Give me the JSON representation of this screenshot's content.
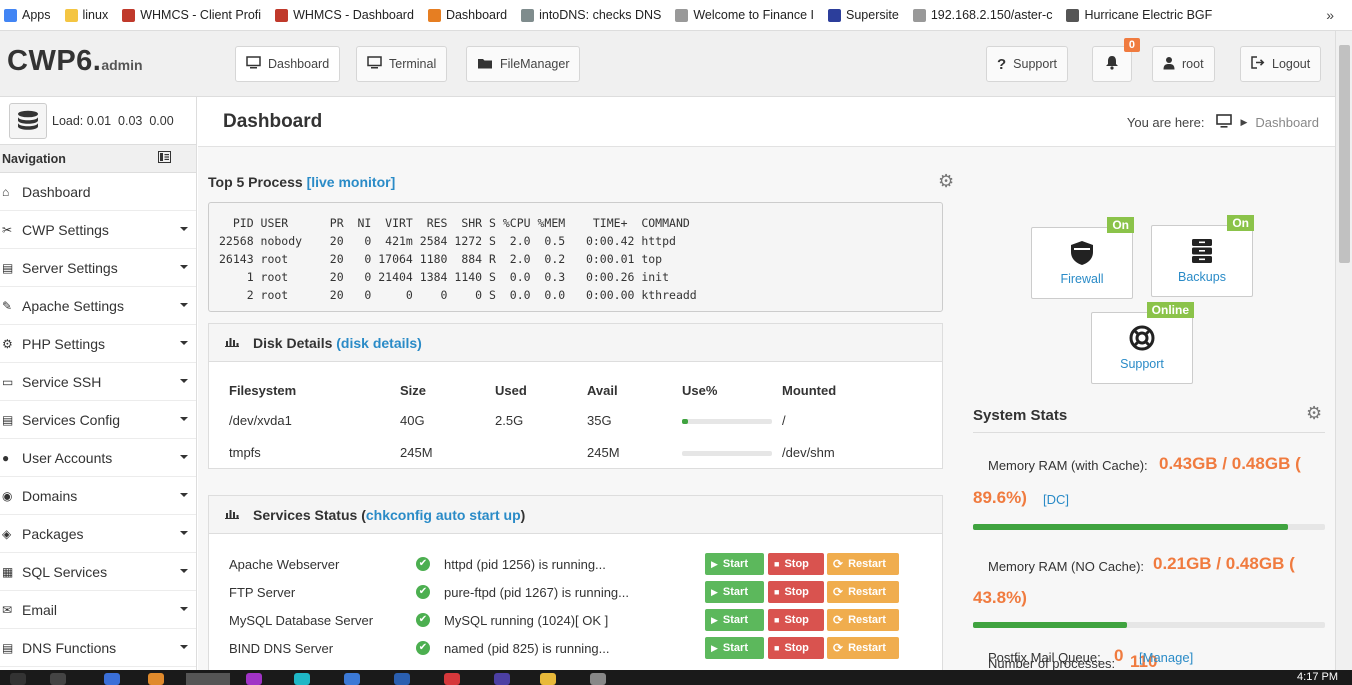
{
  "bookmarks": [
    {
      "label": "Apps",
      "color": "#4285f4"
    },
    {
      "label": "linux",
      "color": "#f4c542"
    },
    {
      "label": "WHMCS - Client Profi",
      "color": "#c0392b"
    },
    {
      "label": "WHMCS - Dashboard",
      "color": "#c0392b"
    },
    {
      "label": "Dashboard",
      "color": "#e67e22"
    },
    {
      "label": "intoDNS: checks DNS",
      "color": "#7f8c8d"
    },
    {
      "label": "Welcome to Finance I",
      "color": "#999999"
    },
    {
      "label": "Supersite",
      "color": "#2c3e9b"
    },
    {
      "label": "192.168.2.150/aster-c",
      "color": "#999999"
    },
    {
      "label": "Hurricane Electric BGF",
      "color": "#555555"
    }
  ],
  "bookmarks_more": "»",
  "brand": {
    "name": "CWP6.",
    "suffix": "admin"
  },
  "topnav": {
    "dashboard": "Dashboard",
    "terminal": "Terminal",
    "filemanager": "FileManager",
    "support": "Support",
    "notifications_count": "0",
    "user": "root",
    "logout": "Logout"
  },
  "sidebar": {
    "load_label": "Load:",
    "load_values": "0.01  0.03  0.00",
    "nav_title": "Navigation",
    "items": [
      {
        "label": "Dashboard",
        "has_caret": false
      },
      {
        "label": "CWP Settings",
        "has_caret": true
      },
      {
        "label": "Server Settings",
        "has_caret": true
      },
      {
        "label": "Apache Settings",
        "has_caret": true
      },
      {
        "label": "PHP Settings",
        "has_caret": true
      },
      {
        "label": "Service SSH",
        "has_caret": true
      },
      {
        "label": "Services Config",
        "has_caret": true
      },
      {
        "label": "User Accounts",
        "has_caret": true
      },
      {
        "label": "Domains",
        "has_caret": true
      },
      {
        "label": "Packages",
        "has_caret": true
      },
      {
        "label": "SQL Services",
        "has_caret": true
      },
      {
        "label": "Email",
        "has_caret": true
      },
      {
        "label": "DNS Functions",
        "has_caret": true
      }
    ]
  },
  "page": {
    "title": "Dashboard",
    "breadcrumb_prefix": "You are here:",
    "breadcrumb_current": "Dashboard"
  },
  "top_process": {
    "title": "Top 5 Process",
    "link": "[live monitor]",
    "output": "  PID USER      PR  NI  VIRT  RES  SHR S %CPU %MEM    TIME+  COMMAND\n22568 nobody    20   0  421m 2584 1272 S  2.0  0.5   0:00.42 httpd\n26143 root      20   0 17064 1180  884 R  2.0  0.2   0:00.01 top\n    1 root      20   0 21404 1384 1140 S  0.0  0.3   0:00.26 init\n    2 root      20   0     0    0    0 S  0.0  0.0   0:00.00 kthreadd"
  },
  "disk": {
    "title": "Disk Details",
    "link": "(disk details)",
    "headers": [
      "Filesystem",
      "Size",
      "Used",
      "Avail",
      "Use%",
      "Mounted"
    ],
    "rows": [
      {
        "fs": "/dev/xvda1",
        "size": "40G",
        "used": "2.5G",
        "avail": "35G",
        "use_pct": 7,
        "mounted": "/"
      },
      {
        "fs": "tmpfs",
        "size": "245M",
        "used": "",
        "avail": "245M",
        "use_pct": 0,
        "mounted": "/dev/shm"
      }
    ]
  },
  "services": {
    "title": "Services Status",
    "link": "chkconfig auto start up",
    "open_paren": "(",
    "close_paren": ")",
    "start_label": "Start",
    "stop_label": "Stop",
    "restart_label": "Restart",
    "rows": [
      {
        "name": "Apache Webserver",
        "status": "httpd (pid 1256) is running..."
      },
      {
        "name": "FTP Server",
        "status": "pure-ftpd (pid 1267) is running..."
      },
      {
        "name": "MySQL Database Server",
        "status": "MySQL running (1024)[ OK ]"
      },
      {
        "name": "BIND DNS Server",
        "status": "named (pid 825) is running..."
      }
    ]
  },
  "shortcuts": [
    {
      "label": "Firewall",
      "badge": "On",
      "icon": "shield-icon"
    },
    {
      "label": "Backups",
      "badge": "On",
      "icon": "database-icon"
    },
    {
      "label": "Support",
      "badge": "Online",
      "icon": "lifebuoy-icon"
    }
  ],
  "system_stats": {
    "title": "System Stats",
    "mem_cache_label": "Memory RAM (with Cache):",
    "mem_cache_value": "0.43GB / 0.48GB (",
    "mem_cache_pct": "89.6%)",
    "mem_cache_link": "[DC]",
    "mem_cache_fill": 89.6,
    "mem_nocache_label": "Memory RAM (NO Cache):",
    "mem_nocache_value": "0.21GB / 0.48GB (",
    "mem_nocache_pct": "43.8%)",
    "mem_nocache_fill": 43.8,
    "processes_label": "Number of processes:",
    "processes_value": "110",
    "mailq_label": "Postfix Mail Queue:",
    "mailq_value": "0",
    "mailq_link": "[Manage]"
  },
  "taskbar": {
    "clock": "4:17 PM"
  },
  "colors": {
    "accent": "#f07b3f",
    "link": "#2a8bc7",
    "success": "#5cb85c",
    "danger": "#d9534f",
    "warning": "#f0ad4e"
  }
}
